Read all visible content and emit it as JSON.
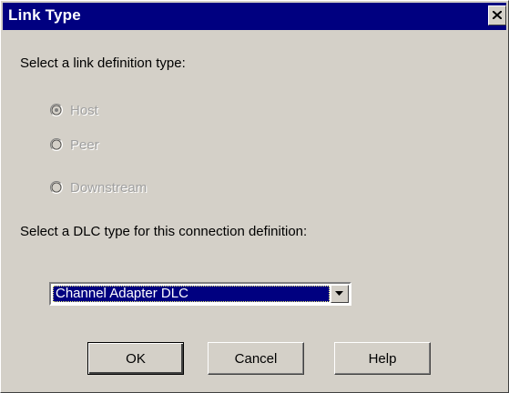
{
  "window": {
    "title": "Link Type"
  },
  "prompts": {
    "link_type": "Select a link definition type:",
    "dlc_type": "Select a DLC type for this connection definition:"
  },
  "radios": [
    {
      "label": "Host",
      "checked": true,
      "disabled": true
    },
    {
      "label": "Peer",
      "checked": false,
      "disabled": true
    },
    {
      "label": "Downstream",
      "checked": false,
      "disabled": true
    }
  ],
  "dlc_select": {
    "value": "Channel Adapter DLC"
  },
  "buttons": {
    "ok": "OK",
    "cancel": "Cancel",
    "help": "Help"
  },
  "colors": {
    "titlebar": "#000080",
    "dialog_face": "#d4d0c8",
    "disabled_text": "#a0a0a0"
  }
}
